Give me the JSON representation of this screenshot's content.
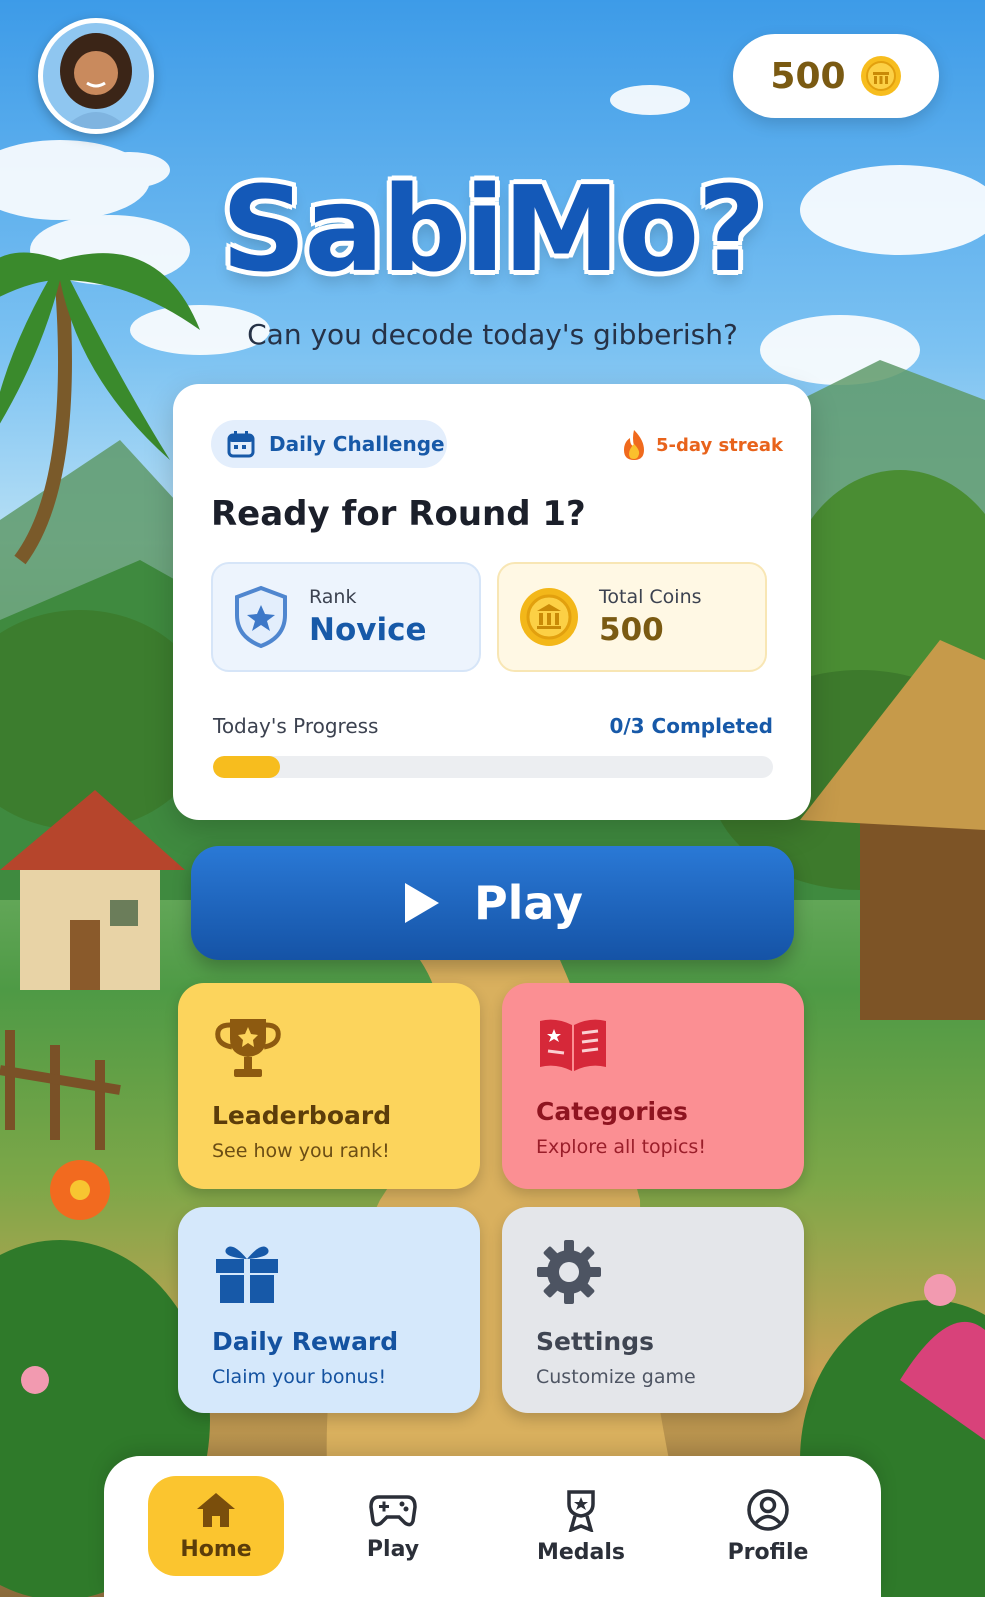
{
  "header": {
    "coins": "500",
    "title": "SabiMo?",
    "subtitle": "Can you decode today's gibberish?"
  },
  "challenge": {
    "badge": "Daily Challenge",
    "streak": "5-day streak",
    "heading": "Ready for Round 1?",
    "rank_label": "Rank",
    "rank_value": "Novice",
    "coins_label": "Total Coins",
    "coins_value": "500",
    "progress_label": "Today's Progress",
    "progress_status": "0/3 Completed",
    "progress_fraction": 0.12
  },
  "play_button": "Play",
  "tiles": [
    {
      "title": "Leaderboard",
      "subtitle": "See how you rank!"
    },
    {
      "title": "Categories",
      "subtitle": "Explore all topics!"
    },
    {
      "title": "Daily Reward",
      "subtitle": "Claim your bonus!"
    },
    {
      "title": "Settings",
      "subtitle": "Customize game"
    }
  ],
  "nav": [
    {
      "label": "Home",
      "icon": "home-icon",
      "active": true
    },
    {
      "label": "Play",
      "icon": "gamepad-icon",
      "active": false
    },
    {
      "label": "Medals",
      "icon": "medal-icon",
      "active": false
    },
    {
      "label": "Profile",
      "icon": "profile-icon",
      "active": false
    }
  ],
  "colors": {
    "primary_blue": "#1759a8",
    "gold": "#f7bd1e",
    "streak_orange": "#e8631b",
    "leaderboard_tile": "#fcd45c",
    "categories_tile": "#fb8f93",
    "reward_tile": "#d5e8fb",
    "settings_tile": "#e4e6ea"
  }
}
